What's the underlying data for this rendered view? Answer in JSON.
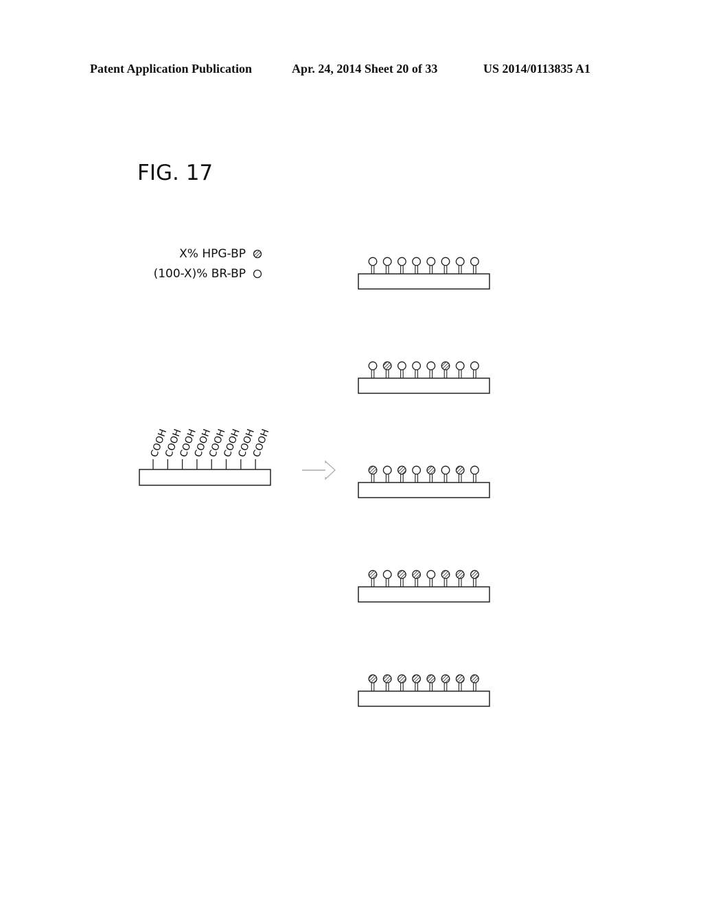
{
  "header": {
    "publication": "Patent Application Publication",
    "date_sheet": "Apr. 24, 2014  Sheet 20 of 33",
    "number": "US 2014/0113835 A1"
  },
  "figure": {
    "title": "FIG. 17"
  },
  "legend": {
    "items": [
      {
        "label": "X% HPG-BP",
        "symbol": "hatched-circle-icon"
      },
      {
        "label": "(100-X)% BR-BP",
        "symbol": "open-circle-icon"
      }
    ]
  },
  "starting_substrate": {
    "group_label": "COOH",
    "group_count": 8
  },
  "arrow": {
    "icon": "right-arrow-icon"
  },
  "product_substrates": [
    {
      "pattern": [
        "O",
        "O",
        "O",
        "O",
        "O",
        "O",
        "O",
        "O"
      ]
    },
    {
      "pattern": [
        "O",
        "H",
        "O",
        "O",
        "O",
        "H",
        "O",
        "O"
      ]
    },
    {
      "pattern": [
        "H",
        "O",
        "H",
        "O",
        "H",
        "O",
        "H",
        "O"
      ]
    },
    {
      "pattern": [
        "H",
        "O",
        "H",
        "H",
        "O",
        "H",
        "H",
        "H"
      ]
    },
    {
      "pattern": [
        "H",
        "H",
        "H",
        "H",
        "H",
        "H",
        "H",
        "H"
      ]
    }
  ]
}
